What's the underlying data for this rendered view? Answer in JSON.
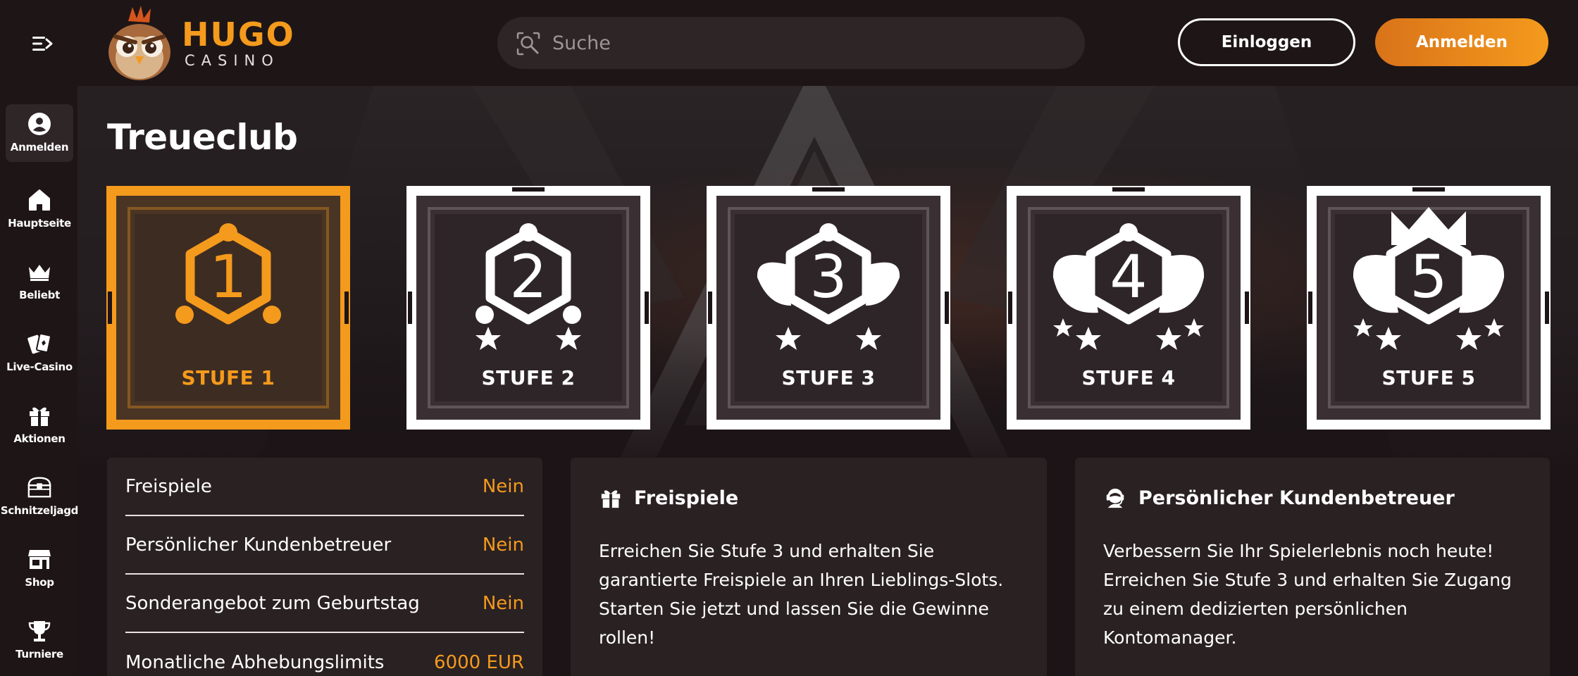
{
  "header": {
    "logo_primary": "HUGO",
    "logo_secondary": "CASINO",
    "search_placeholder": "Suche",
    "login_label": "Einloggen",
    "register_label": "Anmelden"
  },
  "sidebar": {
    "items": [
      {
        "label": "Anmelden",
        "icon": "user-icon",
        "active": true
      },
      {
        "label": "Hauptseite",
        "icon": "home-icon"
      },
      {
        "label": "Beliebt",
        "icon": "crown-icon"
      },
      {
        "label": "Live-Casino",
        "icon": "cards-icon"
      },
      {
        "label": "Aktionen",
        "icon": "gift-icon"
      },
      {
        "label": "Schnitzeljagd",
        "icon": "treasure-chest-icon"
      },
      {
        "label": "Shop",
        "icon": "shop-icon"
      },
      {
        "label": "Turniere",
        "icon": "trophy-icon"
      }
    ]
  },
  "main": {
    "title": "Treueclub",
    "tiers": [
      {
        "number": "1",
        "label": "STUFE 1",
        "active": true
      },
      {
        "number": "2",
        "label": "STUFE 2"
      },
      {
        "number": "3",
        "label": "STUFE 3"
      },
      {
        "number": "4",
        "label": "STUFE 4"
      },
      {
        "number": "5",
        "label": "STUFE 5"
      }
    ],
    "benefits": [
      {
        "label": "Freispiele",
        "value": "Nein"
      },
      {
        "label": "Persönlicher Kundenbetreuer",
        "value": "Nein"
      },
      {
        "label": "Sonderangebot zum Geburtstag",
        "value": "Nein"
      },
      {
        "label": "Monatliche Abhebungslimits",
        "value": "6000 EUR"
      }
    ],
    "info_cards": [
      {
        "icon": "gift-icon",
        "title": "Freispiele",
        "text": "Erreichen Sie Stufe 3 und erhalten Sie garantierte Freispiele an Ihren Lieblings-Slots. Starten Sie jetzt und lassen Sie die Gewinne rollen!"
      },
      {
        "icon": "support-agent-icon",
        "title": "Persönlicher Kundenbetreuer",
        "text": "Verbessern Sie Ihr Spielerlebnis noch heute! Erreichen Sie Stufe 3 und erhalten Sie Zugang zu einem dedizierten persönlichen Kontomanager."
      }
    ]
  },
  "colors": {
    "accent": "#f49a1c",
    "background": "#1c1416",
    "panel": "#2a2123"
  }
}
